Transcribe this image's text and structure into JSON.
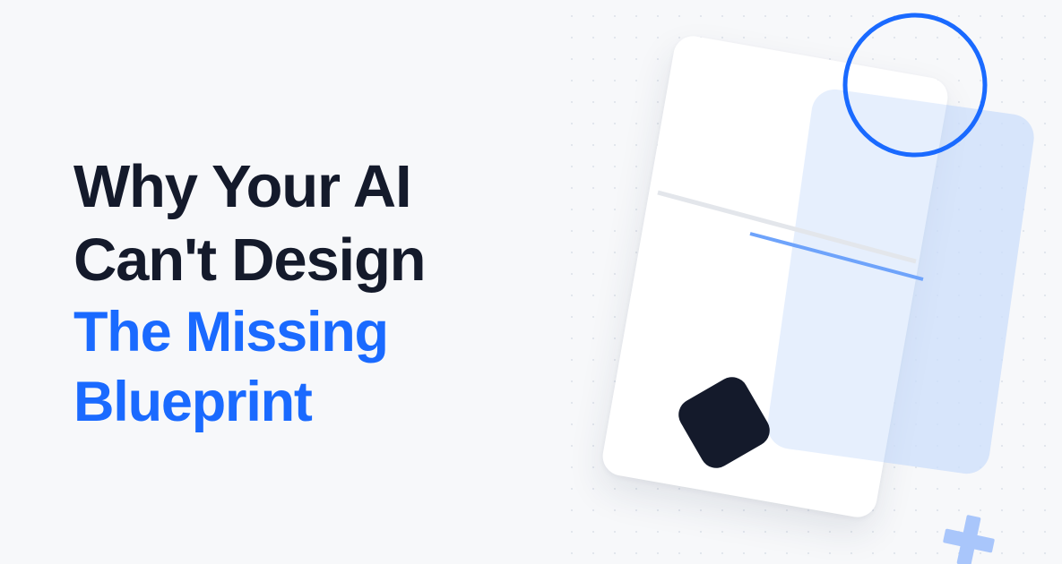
{
  "headline": {
    "line1": "Why Your AI",
    "line2": "Can't Design",
    "line3": "The Missing",
    "line4": "Blueprint"
  },
  "colors": {
    "background": "#f7f8fa",
    "text_dark": "#141a2b",
    "accent_blue": "#1a6aff",
    "light_blue": "#c6dafc",
    "shape_dark": "#141a2b"
  },
  "icons": {
    "circle": "ring-outline",
    "square": "rounded-square",
    "plus": "plus-icon"
  }
}
